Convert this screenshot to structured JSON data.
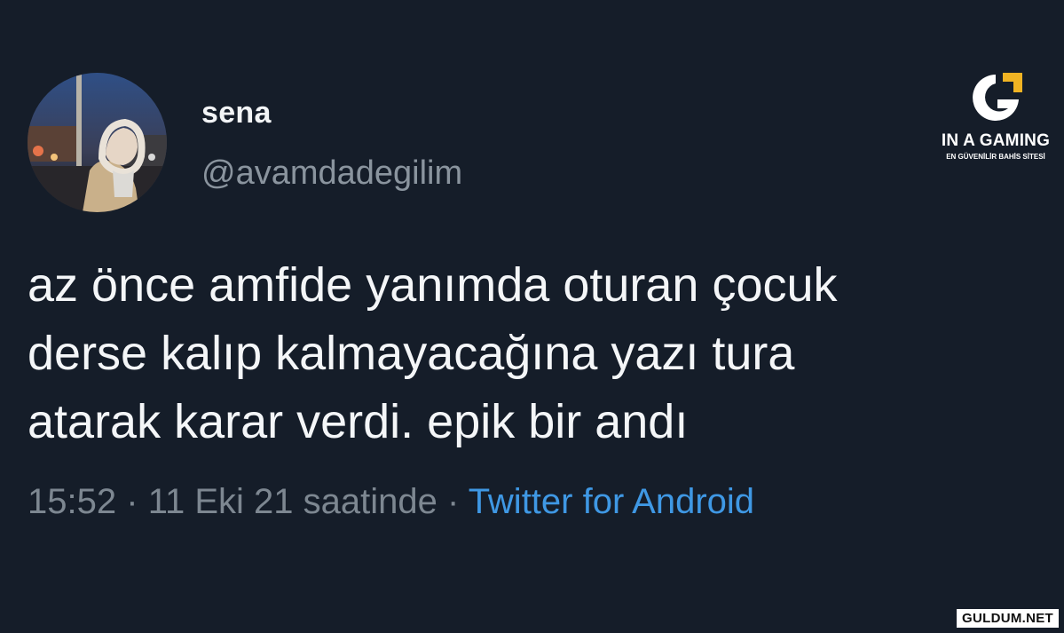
{
  "tweet": {
    "display_name": "sena",
    "handle": "@avamdadegilim",
    "text_lines": [
      "az önce amfide yanımda oturan çocuk",
      "derse kalıp kalmayacağına yazı tura",
      "atarak karar verdi. epik bir andı"
    ],
    "time": "15:52",
    "separator": "·",
    "date": "11 Eki 21 saatinde",
    "source": "Twitter for Android"
  },
  "overlay": {
    "logo_title": "IN A GAMING",
    "logo_subtitle": "EN GÜVENİLİR BAHİS SİTESİ",
    "watermark": "GULDUM.NET"
  },
  "colors": {
    "background": "#151d29",
    "text": "#f4f6f8",
    "muted": "#7d8791",
    "link": "#3f98e4",
    "logo_accent": "#f0b323"
  }
}
